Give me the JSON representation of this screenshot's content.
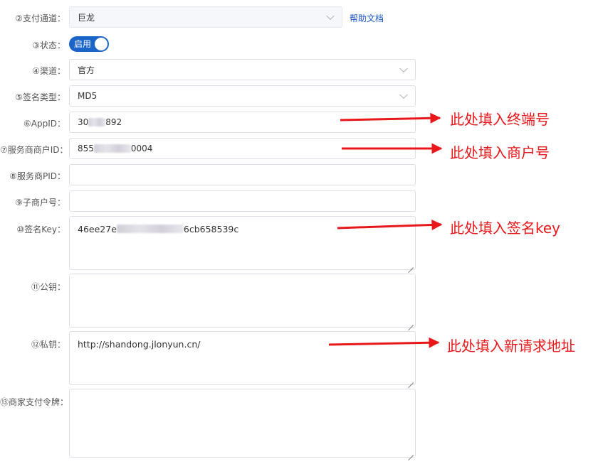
{
  "form": {
    "channel": {
      "label": "②支付通道：",
      "value": "巨龙",
      "help": "帮助文档"
    },
    "status": {
      "label": "③状态：",
      "toggle": "启用"
    },
    "route": {
      "label": "④渠道：",
      "value": "官方"
    },
    "sign_type": {
      "label": "⑤签名类型：",
      "value": "MD5"
    },
    "appid": {
      "label": "⑥AppID：",
      "prefix": "30",
      "suffix": "892"
    },
    "provider_mchid": {
      "label": "⑦服务商商户ID：",
      "prefix": "855",
      "suffix": "0004"
    },
    "provider_pid": {
      "label": "⑧服务商PID：",
      "value": ""
    },
    "sub_mchid": {
      "label": "⑨子商户号：",
      "value": ""
    },
    "sign_key": {
      "label": "⑩签名Key：",
      "prefix": "46ee27e",
      "suffix": "6cb658539c"
    },
    "public_key": {
      "label": "⑪公钥：",
      "value": ""
    },
    "private_key": {
      "label": "⑫私钥：",
      "value": "http://shandong.jlonyun.cn/"
    },
    "merchant_token": {
      "label": "⑬商家支付令牌：",
      "value": ""
    }
  },
  "annotations": {
    "terminal": "此处填入终端号",
    "merchant": "此处填入商户号",
    "key": "此处填入签名key",
    "url": "此处填入新请求地址"
  },
  "colors": {
    "accent": "#1b64c8",
    "link": "#1a56c9",
    "annotation": "#e8171a"
  }
}
